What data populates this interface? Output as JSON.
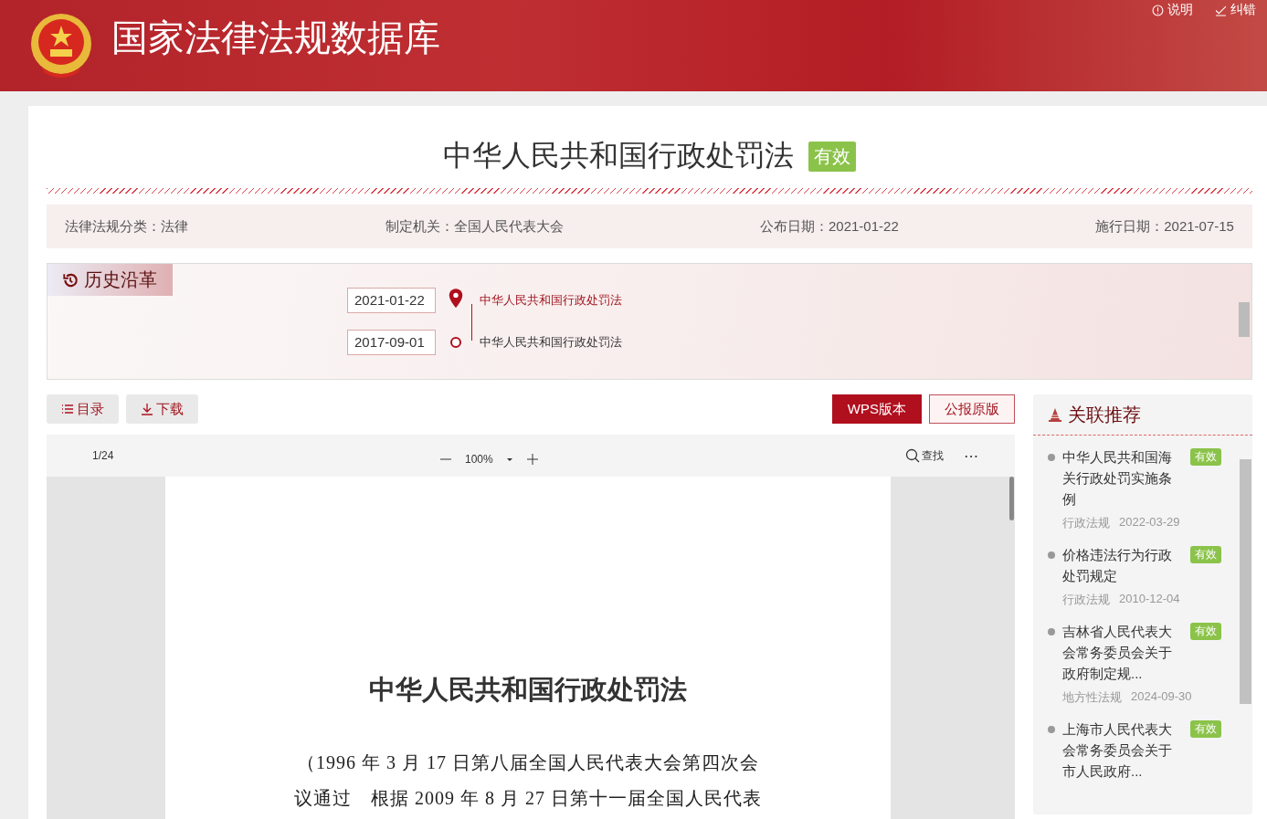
{
  "header": {
    "site_title": "国家法律法规数据库",
    "links": [
      {
        "label": "说明",
        "kind": "info"
      },
      {
        "label": "纠错",
        "kind": "edit"
      }
    ]
  },
  "law": {
    "title": "中华人民共和国行政处罚法",
    "status": "有效"
  },
  "meta": [
    {
      "text": "法律法规分类：法律"
    },
    {
      "text": "制定机关：全国人民代表大会"
    },
    {
      "text": "公布日期：2021-01-22"
    },
    {
      "text": "施行日期：2021-07-15"
    }
  ],
  "history": {
    "tab": "历史沿革",
    "items": [
      {
        "date": "2021-01-22",
        "title": "中华人民共和国行政处罚法",
        "selected": true
      },
      {
        "date": "2017-09-01",
        "title": "中华人民共和国行政处罚法",
        "selected": false
      }
    ]
  },
  "toolbar": {
    "left_buttons": [
      {
        "label": "目录",
        "kind": "list"
      },
      {
        "label": "下载",
        "kind": "download"
      }
    ],
    "right_buttons": [
      {
        "label": "WPS版本",
        "selected": true
      },
      {
        "label": "公报原版",
        "selected": false
      }
    ]
  },
  "viewer": {
    "page": "1/24",
    "zoom": "100%",
    "find": "查找",
    "more": "⋯",
    "doc_title": "中华人民共和国行政处罚法",
    "doc_lines": [
      "（1996 年 3 月 17 日第八届全国人民代表大会第四次会",
      "议通过　根据 2009 年 8 月 27 日第十一届全国人民代表"
    ]
  },
  "related": {
    "heading": "关联推荐",
    "items": [
      {
        "title": "中华人民共和国海关行政处罚实施条例",
        "status": "有效",
        "category": "行政法规",
        "date": "2022-03-29"
      },
      {
        "title": "价格违法行为行政处罚规定",
        "status": "有效",
        "category": "行政法规",
        "date": "2010-12-04"
      },
      {
        "title": "吉林省人民代表大会常务委员会关于政府制定规...",
        "status": "有效",
        "category": "地方性法规",
        "date": "2024-09-30"
      },
      {
        "title": "上海市人民代表大会常务委员会关于市人民政府...",
        "status": "有效"
      }
    ]
  }
}
